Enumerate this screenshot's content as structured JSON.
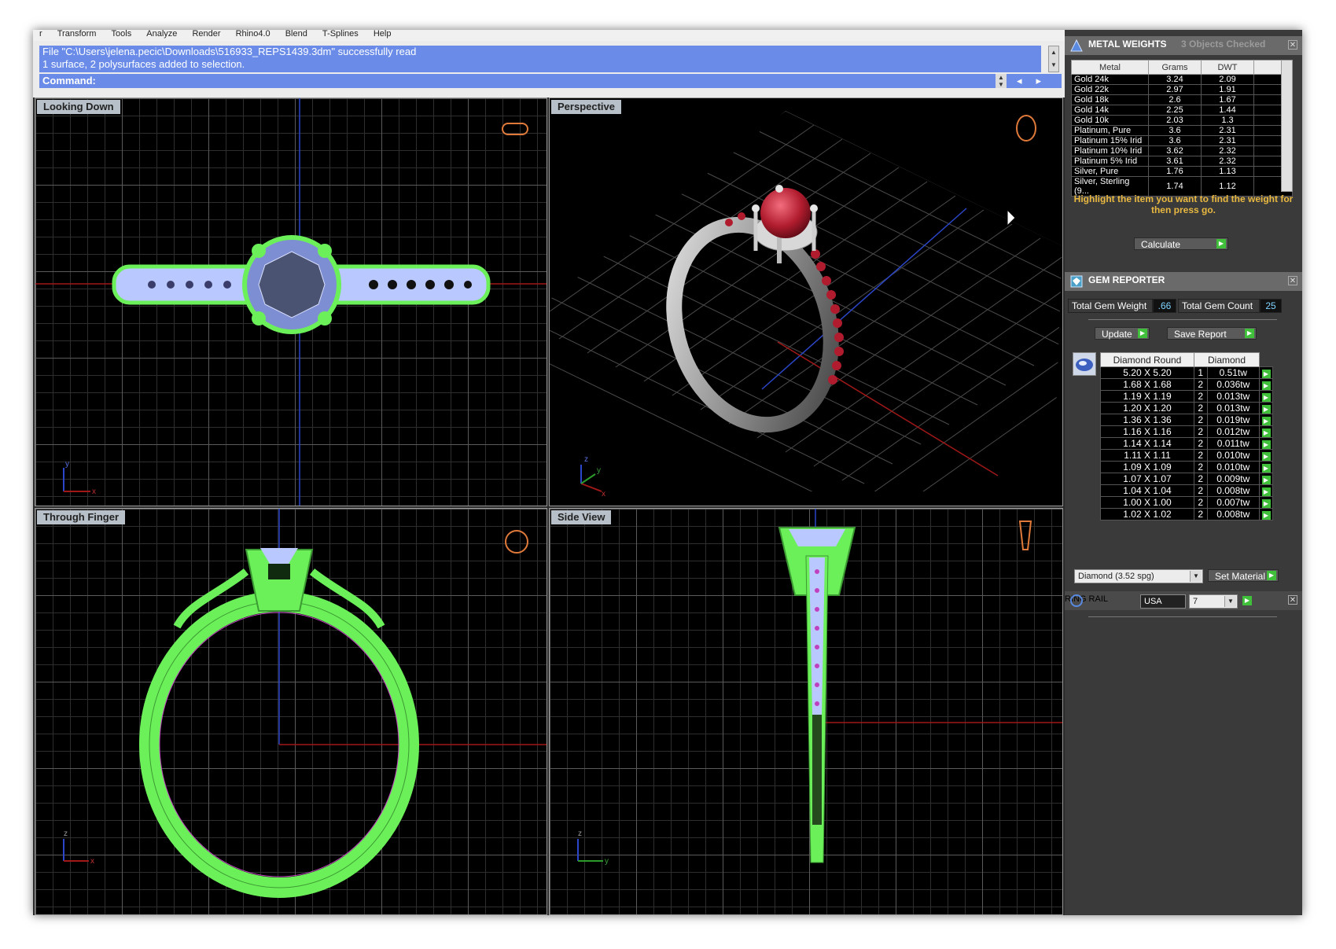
{
  "menu": [
    "Transform",
    "Tools",
    "Analyze",
    "Render",
    "Rhino4.0",
    "Blend",
    "T-Splines",
    "Help"
  ],
  "command_history": {
    "line1": "File \"C:\\Users\\jelena.pecic\\Downloads\\516933_REPS1439.3dm\" successfully read",
    "line2": "1 surface, 2 polysurfaces added to selection."
  },
  "command_prompt": "Command:",
  "viewports": {
    "top_left": "Looking Down",
    "top_right": "Perspective",
    "bottom_left": "Through Finger",
    "bottom_right": "Side View"
  },
  "axes": {
    "looking_down": {
      "x": "x",
      "y": "y"
    },
    "perspective": {
      "x": "x",
      "y": "y",
      "z": "z"
    },
    "through_finger": {
      "x": "x",
      "z": "z"
    },
    "side_view": {
      "y": "y",
      "z": "z"
    }
  },
  "metal_weights": {
    "title": "METAL WEIGHTS",
    "status": "3 Objects Checked",
    "headers": [
      "Metal",
      "Grams",
      "DWT"
    ],
    "rows": [
      [
        "Gold 24k",
        "3.24",
        "2.09"
      ],
      [
        "Gold 22k",
        "2.97",
        "1.91"
      ],
      [
        "Gold 18k",
        "2.6",
        "1.67"
      ],
      [
        "Gold 14k",
        "2.25",
        "1.44"
      ],
      [
        "Gold 10k",
        "2.03",
        "1.3"
      ],
      [
        "Platinum, Pure",
        "3.6",
        "2.31"
      ],
      [
        "Platinum 15% Irid",
        "3.6",
        "2.31"
      ],
      [
        "Platinum 10% Irid",
        "3.62",
        "2.32"
      ],
      [
        "Platinum 5% Irid",
        "3.61",
        "2.32"
      ],
      [
        "Silver, Pure",
        "1.76",
        "1.13"
      ],
      [
        "Silver, Sterling (9...",
        "1.74",
        "1.12"
      ]
    ],
    "instruction": "Highlight the item you want to find the weight for then press go.",
    "calculate_label": "Calculate"
  },
  "gem_reporter": {
    "title": "GEM REPORTER",
    "total_weight_label": "Total Gem Weight",
    "total_weight_value": ".66",
    "total_count_label": "Total Gem Count",
    "total_count_value": "25",
    "update_label": "Update",
    "save_report_label": "Save Report",
    "headers": [
      "Diamond Round",
      "Diamond"
    ],
    "rows": [
      [
        "5.20 X 5.20",
        "1",
        "0.51tw"
      ],
      [
        "1.68 X 1.68",
        "2",
        "0.036tw"
      ],
      [
        "1.19 X 1.19",
        "2",
        "0.013tw"
      ],
      [
        "1.20 X 1.20",
        "2",
        "0.013tw"
      ],
      [
        "1.36 X 1.36",
        "2",
        "0.019tw"
      ],
      [
        "1.16 X 1.16",
        "2",
        "0.012tw"
      ],
      [
        "1.14 X 1.14",
        "2",
        "0.011tw"
      ],
      [
        "1.11 X 1.11",
        "2",
        "0.010tw"
      ],
      [
        "1.09 X 1.09",
        "2",
        "0.010tw"
      ],
      [
        "1.07 X 1.07",
        "2",
        "0.009tw"
      ],
      [
        "1.04 X 1.04",
        "2",
        "0.008tw"
      ],
      [
        "1.00 X 1.00",
        "2",
        "0.007tw"
      ],
      [
        "1.02 X 1.02",
        "2",
        "0.008tw"
      ]
    ],
    "material_select": "Diamond     (3.52 spg)",
    "set_material_label": "Set Material"
  },
  "ring_rail": {
    "title": "RING RAIL",
    "region": "USA",
    "size": "7"
  },
  "colors": {
    "accent_blue": "#6a8ce8",
    "go_green": "#3fbf3a",
    "wire_green": "#6cf05a",
    "ruby": "#b01c2e",
    "note_yellow": "#e9b840"
  }
}
